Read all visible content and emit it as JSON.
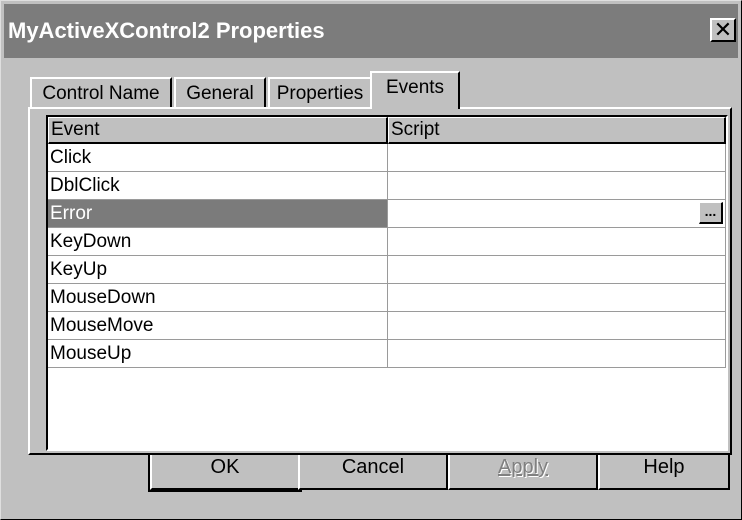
{
  "window": {
    "title": "MyActiveXControl2 Properties",
    "close_glyph": "✕"
  },
  "tabs": [
    {
      "label": "Control Name",
      "active": false
    },
    {
      "label": "General",
      "active": false
    },
    {
      "label": "Properties",
      "active": false
    },
    {
      "label": "Events",
      "active": true
    }
  ],
  "grid": {
    "columns": [
      "Event",
      "Script"
    ],
    "rows": [
      {
        "event": "Click",
        "script": ""
      },
      {
        "event": "DblClick",
        "script": ""
      },
      {
        "event": "Error",
        "script": "",
        "selected": true
      },
      {
        "event": "KeyDown",
        "script": ""
      },
      {
        "event": "KeyUp",
        "script": ""
      },
      {
        "event": "MouseDown",
        "script": ""
      },
      {
        "event": "MouseMove",
        "script": ""
      },
      {
        "event": "MouseUp",
        "script": ""
      }
    ],
    "ellipsis_label": "...",
    "selected_color": "#7b7b7b"
  },
  "buttons": {
    "ok": "OK",
    "cancel": "Cancel",
    "apply": "Apply",
    "help": "Help"
  }
}
